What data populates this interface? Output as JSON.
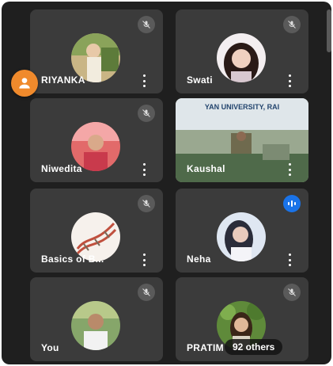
{
  "participants": [
    {
      "name": "RIYANKA",
      "muted": true
    },
    {
      "name": "Swati",
      "muted": true
    },
    {
      "name": "Niwedita",
      "muted": true
    },
    {
      "name": "Kaushal",
      "muted": false,
      "video_banner_text": "YAN UNIVERSITY, RAI"
    },
    {
      "name": "Basics of B...",
      "muted": true
    },
    {
      "name": "Neha",
      "muted": false,
      "speaking": true
    },
    {
      "name": "You",
      "muted": true
    },
    {
      "name": "PRATIM",
      "muted": true,
      "others_label": "92 others"
    }
  ],
  "icons": {
    "muted": "mic-off-icon",
    "speaking": "audio-level-icon",
    "more": "more-vert-icon",
    "self_view": "person-icon"
  },
  "colors": {
    "background": "#1f1f1f",
    "tile": "#3b3b3b",
    "mute_badge": "#5a5a5a",
    "speaking_badge": "#1a73e8",
    "self_avatar": "#f08a2c"
  }
}
